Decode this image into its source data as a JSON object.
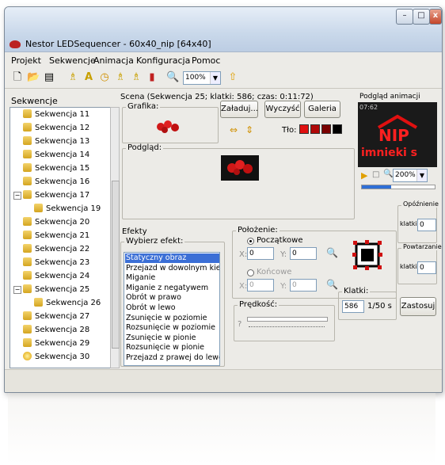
{
  "window": {
    "title": "Nestor LEDSequencer - 60x40_nip [64x40]",
    "controls": {
      "minimize": "–",
      "maximize": "□",
      "close": "x"
    }
  },
  "menu": [
    "Projekt",
    "Sekwencje",
    "Animacja",
    "Konfiguracja",
    "Pomoc"
  ],
  "toolbar": {
    "icons": [
      "new-file-icon",
      "open-folder-icon",
      "save-icon",
      "sequence-icon",
      "text-a-icon",
      "clock-icon",
      "add-sequence-icon",
      "add-sequence-alt-icon",
      "delete-icon",
      "zoom-icon",
      "up-arrow-icon"
    ],
    "zoom": "100%"
  },
  "sidebar": {
    "title": "Sekwencje",
    "items": [
      {
        "label": "Sekwencja 11",
        "indent": 1
      },
      {
        "label": "Sekwencja 12",
        "indent": 1
      },
      {
        "label": "Sekwencja 13",
        "indent": 1
      },
      {
        "label": "Sekwencja 14",
        "indent": 1
      },
      {
        "label": "Sekwencja 15",
        "indent": 1
      },
      {
        "label": "Sekwencja 16",
        "indent": 1
      },
      {
        "label": "Sekwencja 17",
        "indent": 1,
        "expander": "−"
      },
      {
        "label": "Sekwencja 19",
        "indent": 2
      },
      {
        "label": "Sekwencja 20",
        "indent": 1
      },
      {
        "label": "Sekwencja 21",
        "indent": 1
      },
      {
        "label": "Sekwencja 22",
        "indent": 1
      },
      {
        "label": "Sekwencja 23",
        "indent": 1
      },
      {
        "label": "Sekwencja 24",
        "indent": 1
      },
      {
        "label": "Sekwencja 25",
        "indent": 1,
        "expander": "−"
      },
      {
        "label": "Sekwencja 26",
        "indent": 2
      },
      {
        "label": "Sekwencja 27",
        "indent": 1
      },
      {
        "label": "Sekwencja 28",
        "indent": 1
      },
      {
        "label": "Sekwencja 29",
        "indent": 1
      },
      {
        "label": "Sekwencja 30",
        "indent": 1,
        "clock": true
      }
    ]
  },
  "scene": {
    "title": "Scena (Sekwencja 25; klatki: 586; czas: 0:11:72)",
    "graphic_label": "Grafika:",
    "load_button": "Załaduj...",
    "clear_button": "Wyczyść",
    "gallery_button": "Galeria",
    "background_label": "Tło:",
    "preview_label": "Podgląd:",
    "swatches": [
      "#e01010",
      "#b00808",
      "#7a0000",
      "#000000"
    ]
  },
  "preview": {
    "title": "Podgląd animacji",
    "time": "07:62",
    "text_top": "NIP",
    "text_bottom": "imnieki s",
    "zoom": "200%"
  },
  "effects": {
    "title": "Efekty",
    "choose_label": "Wybierz efekt:",
    "list": [
      "Statyczny obraz",
      "Przejazd w dowolnym kierunku",
      "Miganie",
      "Miganie z negatywem",
      "Obrót w prawo",
      "Obrót w lewo",
      "Zsunięcie w poziomie",
      "Rozsunięcie w poziomie",
      "Zsunięcie w pionie",
      "Rozsunięcie w pionie",
      "Przejazd z prawej do lewej"
    ],
    "selected": 0
  },
  "position": {
    "title": "Położenie:",
    "start_label": "Początkowe",
    "end_label": "Końcowe",
    "x_label": "X:",
    "y_label": "Y:",
    "start_x": "0",
    "start_y": "0",
    "end_x": "0",
    "end_y": "0"
  },
  "speed": {
    "title": "Prędkość:",
    "value_label": "?"
  },
  "frames": {
    "title": "Klatki:",
    "value": "586",
    "rate": "1/50 s"
  },
  "apply_button": "Zastosuj",
  "delay": {
    "title": "Opóźnienie",
    "label": "klatki:",
    "value": "0"
  },
  "repeat": {
    "title": "Powtarzanie",
    "label": "klatki:",
    "value": "0"
  }
}
